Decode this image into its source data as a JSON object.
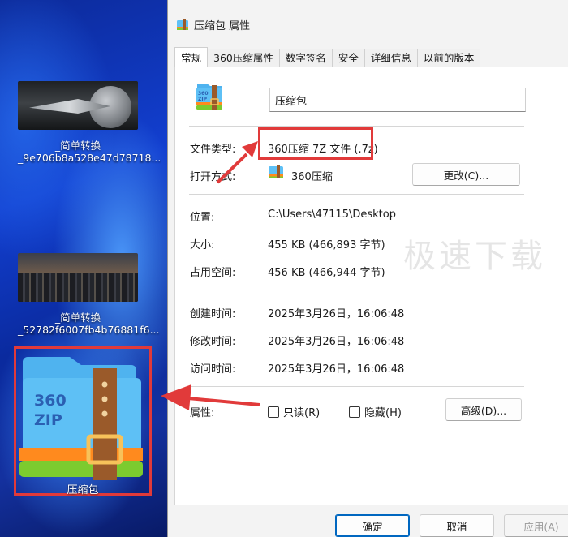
{
  "desktop": {
    "items": [
      {
        "label": "_简单转换_9e706b8a528e47d78718..."
      },
      {
        "label": "_简单转换_52782f6007fb4b76881f6..."
      }
    ],
    "big_icon": {
      "text_top": "360",
      "text_bottom": "ZIP",
      "label": "压缩包"
    }
  },
  "dialog": {
    "title": "压缩包 属性",
    "tabs": [
      "常规",
      "360压缩属性",
      "数字签名",
      "安全",
      "详细信息",
      "以前的版本"
    ],
    "active_tab": "常规",
    "file_name": "压缩包",
    "type_label": "文件类型:",
    "type_value": "360压缩 7Z 文件 (.7z)",
    "open_label": "打开方式:",
    "open_value": "360压缩",
    "change_button": "更改(C)...",
    "location_label": "位置:",
    "location_value": "C:\\Users\\47115\\Desktop",
    "size_label": "大小:",
    "size_value": "455 KB (466,893 字节)",
    "disk_label": "占用空间:",
    "disk_value": "456 KB (466,944 字节)",
    "created_label": "创建时间:",
    "created_value": "2025年3月26日，16:06:48",
    "modified_label": "修改时间:",
    "modified_value": "2025年3月26日，16:06:48",
    "accessed_label": "访问时间:",
    "accessed_value": "2025年3月26日，16:06:48",
    "attr_label": "属性:",
    "readonly_label": "只读(R)",
    "hidden_label": "隐藏(H)",
    "advanced_button": "高级(D)...",
    "watermark": "极速下载",
    "ok_button": "确定",
    "cancel_button": "取消",
    "apply_button": "应用(A)"
  },
  "colors": {
    "highlight": "#e13a3a",
    "accent": "#0067c0"
  }
}
